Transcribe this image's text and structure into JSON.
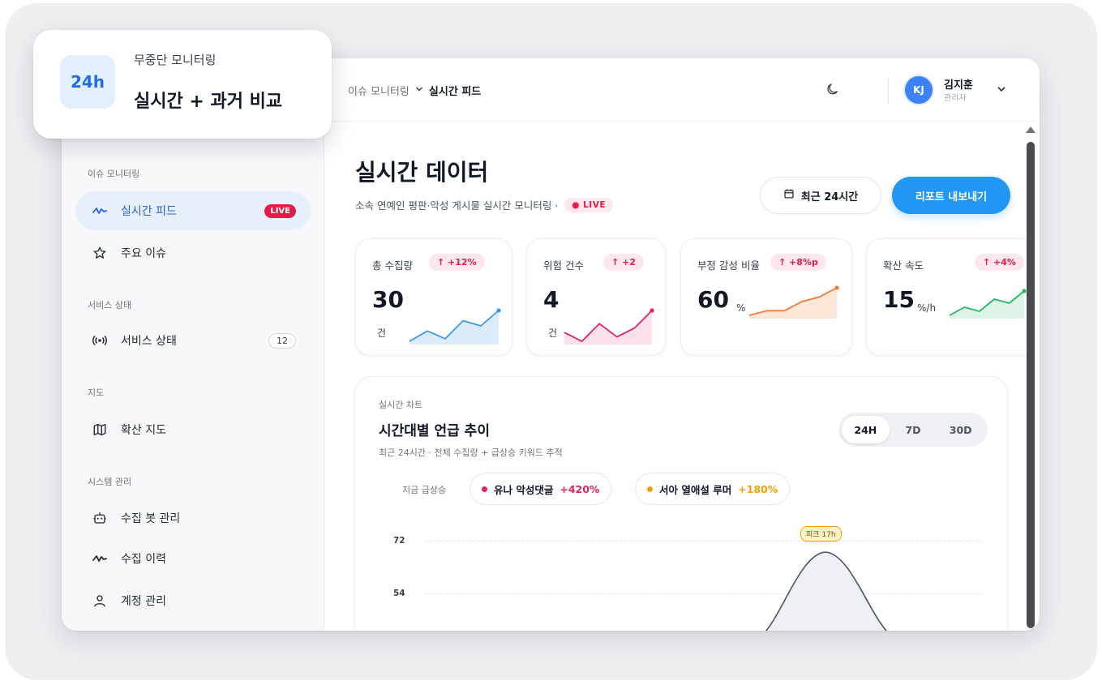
{
  "callout": {
    "badge": "24h",
    "small": "무중단 모니터링",
    "big": "실시간 + 과거 비교"
  },
  "header": {
    "breadcrumb_parent": "이슈 모니터링",
    "breadcrumb_current": "실시간 피드",
    "user_initials": "KJ",
    "user_name": "김지훈",
    "user_role": "관리자"
  },
  "sidebar": {
    "sections": {
      "issue": "이슈 모니터링",
      "service": "서비스 상태",
      "map": "지도",
      "system": "시스템 관리"
    },
    "items": {
      "feed": {
        "label": "실시간 피드",
        "badge": "LIVE",
        "icon": "activity-icon"
      },
      "issues": {
        "label": "주요 이슈",
        "icon": "star-icon"
      },
      "service": {
        "label": "서비스 상태",
        "badge": "12",
        "icon": "broadcast-icon"
      },
      "map": {
        "label": "확산 지도",
        "icon": "map-icon"
      },
      "bots": {
        "label": "수집 봇 관리",
        "icon": "bot-icon"
      },
      "history": {
        "label": "수집 이력",
        "icon": "activity-icon"
      },
      "accounts": {
        "label": "계정 관리",
        "icon": "user-icon"
      }
    }
  },
  "page": {
    "title": "실시간 데이터",
    "subtitle": "소속 연예인 평판·악성 게시물 실시간 모니터링 ·",
    "live": "● LIVE",
    "range_button": "최근 24시간",
    "export_button": "리포트 내보내기"
  },
  "kpis": [
    {
      "label": "총 수집량",
      "delta": "↑ +12%",
      "value": "30",
      "unit": "건",
      "color": "#3b9be8",
      "fill": "#dcebfa",
      "spark": [
        2,
        4,
        2.5,
        6,
        5,
        8
      ]
    },
    {
      "label": "위험 건수",
      "delta": "↑ +2",
      "value": "4",
      "unit": "건",
      "color": "#e0245e",
      "fill": "#fbe1e8",
      "spark": [
        4,
        2,
        6,
        3,
        5,
        9
      ]
    },
    {
      "label": "부정 감성 비율",
      "delta": "↑ +8%p",
      "value": "60",
      "unit": "%",
      "color": "#f27a3c",
      "fill": "#fde5d7",
      "spark": [
        2,
        3,
        3,
        5,
        6,
        8
      ]
    },
    {
      "label": "확산 속도",
      "delta": "↑ +4%",
      "value": "15",
      "unit": "%/h",
      "color": "#2bb56b",
      "fill": "#dcf3e5",
      "spark": [
        3,
        5,
        4,
        7,
        6,
        9
      ]
    }
  ],
  "chart": {
    "kicker": "실시간 차트",
    "title": "시간대별 언급 추이",
    "desc": "최근 24시간 · 전체 수집량 + 급상승 키워드 추적",
    "ranges": [
      "24H",
      "7D",
      "30D"
    ],
    "active_range": "24H",
    "trend_label": "지금 급상승",
    "trends": [
      {
        "name": "유나 악성댓글",
        "change": "+420%",
        "color": "#e0245e"
      },
      {
        "name": "서아 열애설 루머",
        "change": "+180%",
        "color": "#f59e0b"
      }
    ],
    "peak_label": "피크 17h"
  },
  "chart_data": {
    "type": "area",
    "title": "시간대별 언급 추이",
    "y_ticks": [
      72,
      54
    ],
    "annotation": "피크 17h",
    "peak_value": 69
  }
}
